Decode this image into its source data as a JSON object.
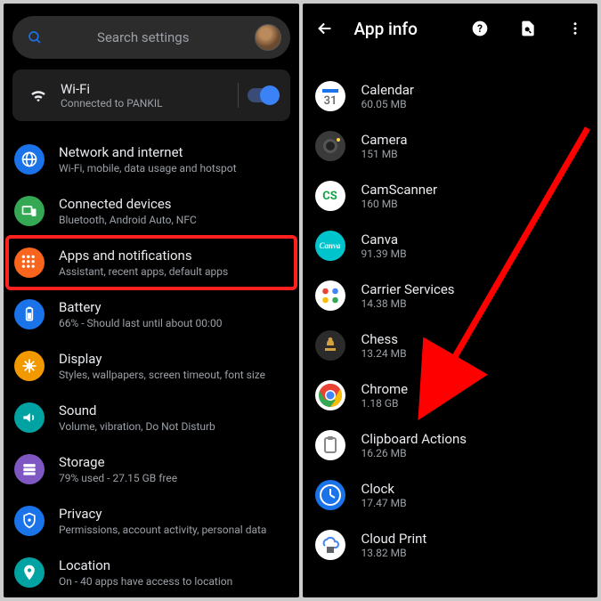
{
  "left": {
    "search_placeholder": "Search settings",
    "wifi": {
      "title": "Wi-Fi",
      "sub": "Connected to PANKIL"
    },
    "items": [
      {
        "title": "Network and internet",
        "sub": "Wi-Fi, mobile, data usage and hotspot",
        "color": "#1a73e8",
        "icon": "globe"
      },
      {
        "title": "Connected devices",
        "sub": "Bluetooth, Android Auto, NFC",
        "color": "#34a853",
        "icon": "devices"
      },
      {
        "title": "Apps and notifications",
        "sub": "Assistant, recent apps, default apps",
        "color": "#f9651c",
        "icon": "apps",
        "highlight": true
      },
      {
        "title": "Battery",
        "sub": "66% - Should last until about 00:00",
        "color": "#1a73e8",
        "icon": "battery"
      },
      {
        "title": "Display",
        "sub": "Styles, wallpapers, screen timeout, font size",
        "color": "#f29900",
        "icon": "display"
      },
      {
        "title": "Sound",
        "sub": "Volume, vibration, Do Not Disturb",
        "color": "#00a2a2",
        "icon": "sound"
      },
      {
        "title": "Storage",
        "sub": "79% used - 27.15 GB free",
        "color": "#7e57c2",
        "icon": "storage"
      },
      {
        "title": "Privacy",
        "sub": "Permissions, account activity, personal data",
        "color": "#1a73e8",
        "icon": "privacy"
      },
      {
        "title": "Location",
        "sub": "On - 40 apps have access to location",
        "color": "#00a2a2",
        "icon": "location"
      }
    ]
  },
  "right": {
    "title": "App info",
    "apps": [
      {
        "name": "Calendar",
        "size": "60.05 MB",
        "bg": "#fff",
        "fg": "#1a73e8",
        "label": "31",
        "shape": "calendar"
      },
      {
        "name": "Camera",
        "size": "151 MB",
        "bg": "#3a3a3a",
        "fg": "#fff",
        "shape": "camera"
      },
      {
        "name": "CamScanner",
        "size": "160 MB",
        "bg": "#fff",
        "fg": "#14a248",
        "label": "CS",
        "shape": "text"
      },
      {
        "name": "Canva",
        "size": "91.39 MB",
        "bg": "#00c4cc",
        "fg": "#fff",
        "label": "Canva",
        "shape": "canva"
      },
      {
        "name": "Carrier Services",
        "size": "14.38 MB",
        "bg": "#fff",
        "shape": "carrier"
      },
      {
        "name": "Chess",
        "size": "13.24 MB",
        "bg": "#2b2b2b",
        "shape": "chess"
      },
      {
        "name": "Chrome",
        "size": "1.18 GB",
        "bg": "#fff",
        "shape": "chrome"
      },
      {
        "name": "Clipboard Actions",
        "size": "16.26 MB",
        "bg": "#fff",
        "fg": "#888",
        "shape": "clipboard"
      },
      {
        "name": "Clock",
        "size": "17.47 MB",
        "bg": "#1a73e8",
        "fg": "#fff",
        "shape": "clock"
      },
      {
        "name": "Cloud Print",
        "size": "13.82 MB",
        "bg": "#fff",
        "shape": "cloudprint"
      }
    ]
  }
}
